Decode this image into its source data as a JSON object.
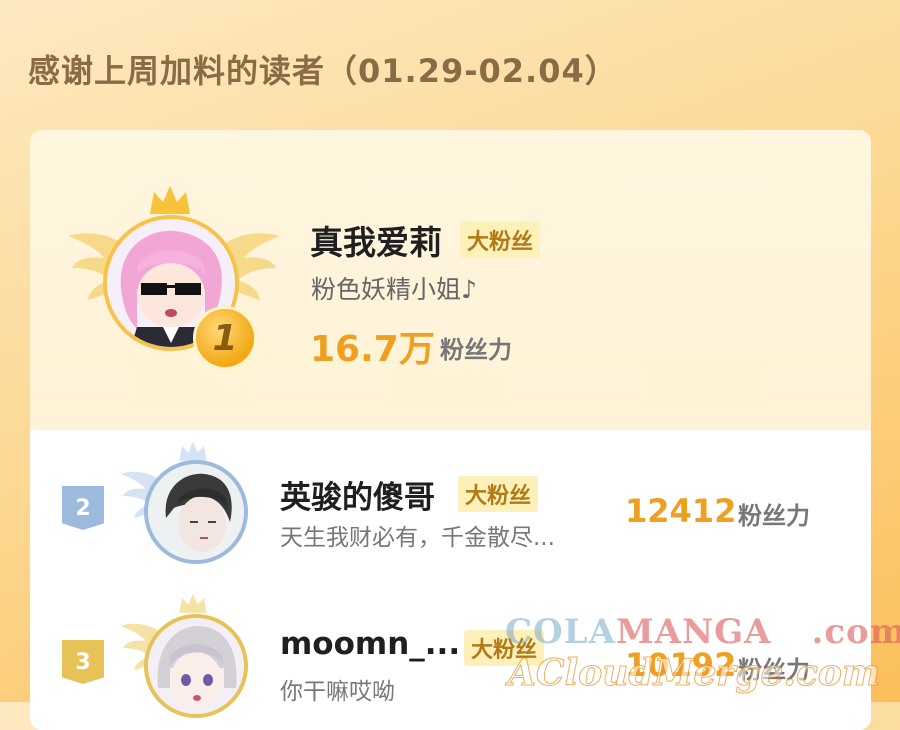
{
  "header": {
    "title": "感谢上周加料的读者（01.29-02.04）"
  },
  "top_reader": {
    "rank": "1",
    "name": "真我爱莉",
    "badge": "大粉丝",
    "signature": "粉色妖精小姐♪",
    "fans_value": "16.7万",
    "fans_label": "粉丝力"
  },
  "readers": [
    {
      "rank": "2",
      "name": "英骏的傻哥",
      "badge": "大粉丝",
      "signature": "天生我财必有，千金散尽...",
      "fans_value": "12412",
      "fans_label": "粉丝力"
    },
    {
      "rank": "3",
      "name": "moomn_...",
      "badge": "大粉丝",
      "signature": "你干嘛哎呦",
      "fans_value": "10192",
      "fans_label": "粉丝力"
    }
  ],
  "watermark": {
    "line1_a": "COLA",
    "line1_b": "MANGA",
    "line1_c": ".com",
    "line2": "ACloudMerge.com"
  },
  "colors": {
    "accent": "#f0a020",
    "badge_bg": "#fdf0b8",
    "rank2": "#8fb0d8",
    "rank3": "#e0b84a"
  }
}
